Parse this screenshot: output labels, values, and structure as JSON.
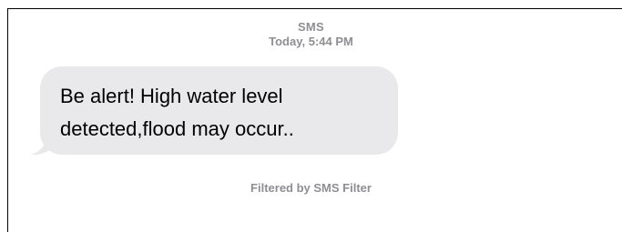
{
  "conversation": {
    "service_label": "SMS",
    "timestamp": "Today, 5:44 PM"
  },
  "message": {
    "text": "Be alert! High water level\ndetected,flood may occur.."
  },
  "footer": {
    "filter_note": "Filtered by SMS Filter"
  },
  "colors": {
    "bubble_background": "#e9e9eb",
    "secondary_text": "#8e8e93",
    "message_text": "#000000"
  }
}
